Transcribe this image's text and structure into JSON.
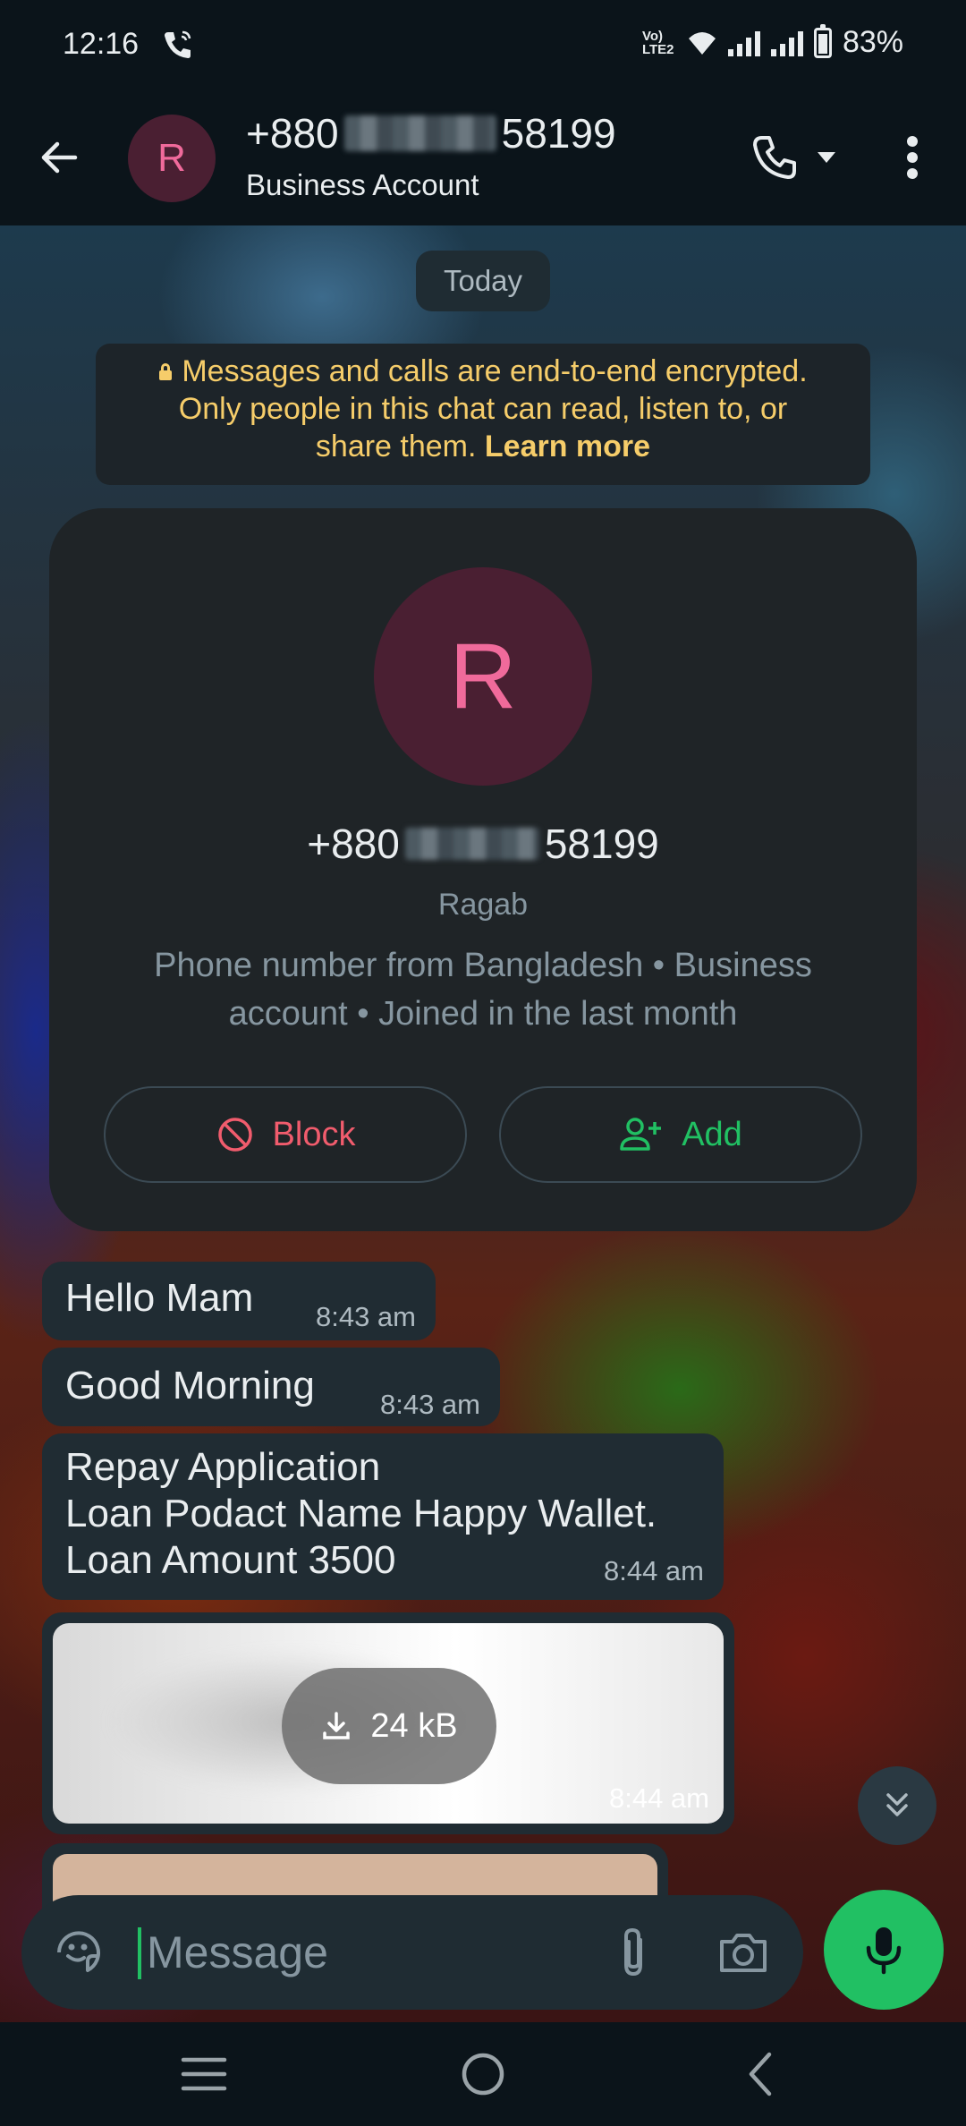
{
  "status_bar": {
    "time": "12:16",
    "network_label": "Vo) LTE2",
    "battery": "83%",
    "battery_level": 0.83
  },
  "header": {
    "avatar_letter": "R",
    "number_prefix": "+880",
    "number_suffix": "58199",
    "subtitle": "Business Account"
  },
  "chat": {
    "date_label": "Today",
    "encryption": {
      "line1": "Messages and calls are end-to-end encrypted.",
      "line2": "Only people in this chat can read, listen to, or",
      "line3": "share them.",
      "learn_more": "Learn more"
    },
    "profile_card": {
      "avatar_letter": "R",
      "number_prefix": "+880",
      "number_suffix": "58199",
      "name": "Ragab",
      "description": "Phone number from Bangladesh • Business account • Joined in the last month",
      "block_label": "Block",
      "add_label": "Add"
    },
    "messages": [
      {
        "text": "Hello Mam",
        "time": "8:43 am"
      },
      {
        "text": "Good Morning",
        "time": "8:43 am"
      },
      {
        "lines": [
          "Repay Application",
          "Loan Podact Name Happy Wallet.",
          "Loan Amount 3500"
        ],
        "time": "8:44 am"
      }
    ],
    "image_message": {
      "size": "24 kB",
      "time": "8:44 am"
    }
  },
  "composer": {
    "placeholder": "Message"
  },
  "colors": {
    "accent": "#21c063",
    "encryption_text": "#f6cd6a",
    "block_red": "#f15c6d",
    "avatar_bg": "#4a1f32",
    "avatar_fg": "#f06a9b"
  }
}
